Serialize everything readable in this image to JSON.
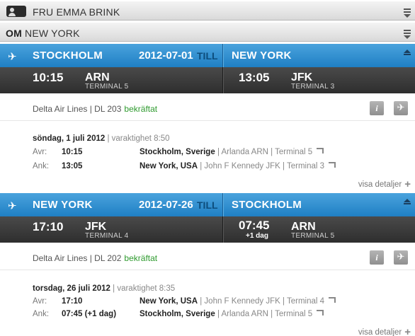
{
  "passenger": {
    "name": "FRU EMMA BRINK"
  },
  "about": {
    "prefix": "OM",
    "destination": "NEW YORK"
  },
  "flights": [
    {
      "from_city": "STOCKHOLM",
      "date": "2012-07-01",
      "till": "TILL",
      "to_city": "NEW YORK",
      "dep_time": "10:15",
      "dep_code": "ARN",
      "dep_terminal": "TERMINAL 5",
      "arr_time": "13:05",
      "arr_plus": "",
      "arr_code": "JFK",
      "arr_terminal": "TERMINAL 3",
      "airline": "Delta Air Lines | DL 203",
      "status": "bekräftat",
      "day": "söndag, 1 juli 2012",
      "duration": "| varaktighet 8:50",
      "dep_label": "Avr:",
      "dep_time_detail": "10:15",
      "dep_place": "Stockholm, Sverige",
      "dep_place_extra": "| Arlanda ARN | Terminal 5",
      "arr_label": "Ank:",
      "arr_time_detail": "13:05",
      "arr_place": "New York, USA",
      "arr_place_extra": "| John F Kennedy JFK | Terminal 3",
      "details_link": "visa detaljer"
    },
    {
      "from_city": "NEW YORK",
      "date": "2012-07-26",
      "till": "TILL",
      "to_city": "STOCKHOLM",
      "dep_time": "17:10",
      "dep_code": "JFK",
      "dep_terminal": "TERMINAL 4",
      "arr_time": "07:45",
      "arr_plus": "+1 dag",
      "arr_code": "ARN",
      "arr_terminal": "TERMINAL 5",
      "airline": "Delta Air Lines | DL 202",
      "status": "bekräftat",
      "day": "torsdag, 26 juli 2012",
      "duration": "| varaktighet 8:35",
      "dep_label": "Avr:",
      "dep_time_detail": "17:10",
      "dep_place": "New York, USA",
      "dep_place_extra": "| John F Kennedy JFK | Terminal 4",
      "arr_label": "Ank:",
      "arr_time_detail": "07:45 (+1 dag)",
      "arr_place": "Stockholm, Sverige",
      "arr_place_extra": "| Arlanda ARN | Terminal 5",
      "details_link": "visa detaljer"
    }
  ],
  "icons": {
    "info": "i",
    "plane": "✈"
  }
}
